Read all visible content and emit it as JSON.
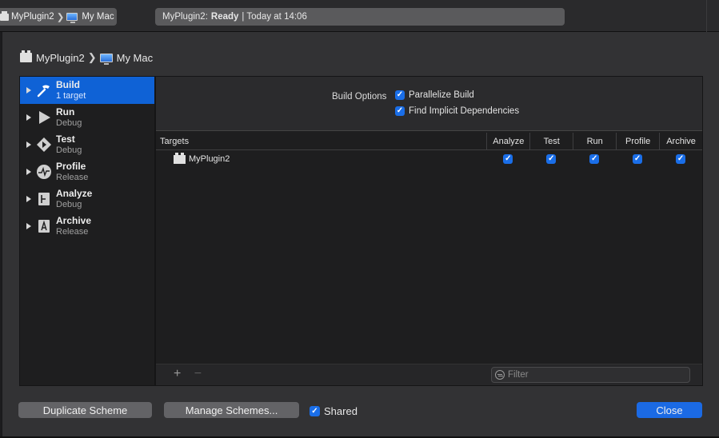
{
  "toolbar": {
    "scheme_name": "MyPlugin2",
    "destination": "My Mac",
    "status_project": "MyPlugin2:",
    "status_state": "Ready",
    "status_time": "| Today at 14:06"
  },
  "breadcrumb": {
    "scheme": "MyPlugin2",
    "destination": "My Mac"
  },
  "actions": [
    {
      "title": "Build",
      "subtitle": "1 target",
      "icon": "hammer-icon",
      "selected": true
    },
    {
      "title": "Run",
      "subtitle": "Debug",
      "icon": "play-icon"
    },
    {
      "title": "Test",
      "subtitle": "Debug",
      "icon": "test-diamond-icon"
    },
    {
      "title": "Profile",
      "subtitle": "Release",
      "icon": "instruments-icon"
    },
    {
      "title": "Analyze",
      "subtitle": "Debug",
      "icon": "analyze-icon"
    },
    {
      "title": "Archive",
      "subtitle": "Release",
      "icon": "archive-icon"
    }
  ],
  "build_options": {
    "label": "Build Options",
    "parallelize": {
      "label": "Parallelize Build",
      "checked": true
    },
    "implicit_deps": {
      "label": "Find Implicit Dependencies",
      "checked": true
    }
  },
  "targets_table": {
    "headers": [
      "Targets",
      "Analyze",
      "Test",
      "Run",
      "Profile",
      "Archive"
    ],
    "rows": [
      {
        "name": "MyPlugin2",
        "analyze": true,
        "test": true,
        "run": true,
        "profile": true,
        "archive": true
      }
    ]
  },
  "footer": {
    "add": "+",
    "remove": "−",
    "filter_placeholder": "Filter"
  },
  "buttons": {
    "duplicate": "Duplicate Scheme",
    "manage": "Manage Schemes...",
    "shared_label": "Shared",
    "shared_checked": true,
    "close": "Close"
  },
  "colors": {
    "accent": "#1b6ae4",
    "selection": "#0f62d6",
    "background": "#323234"
  }
}
